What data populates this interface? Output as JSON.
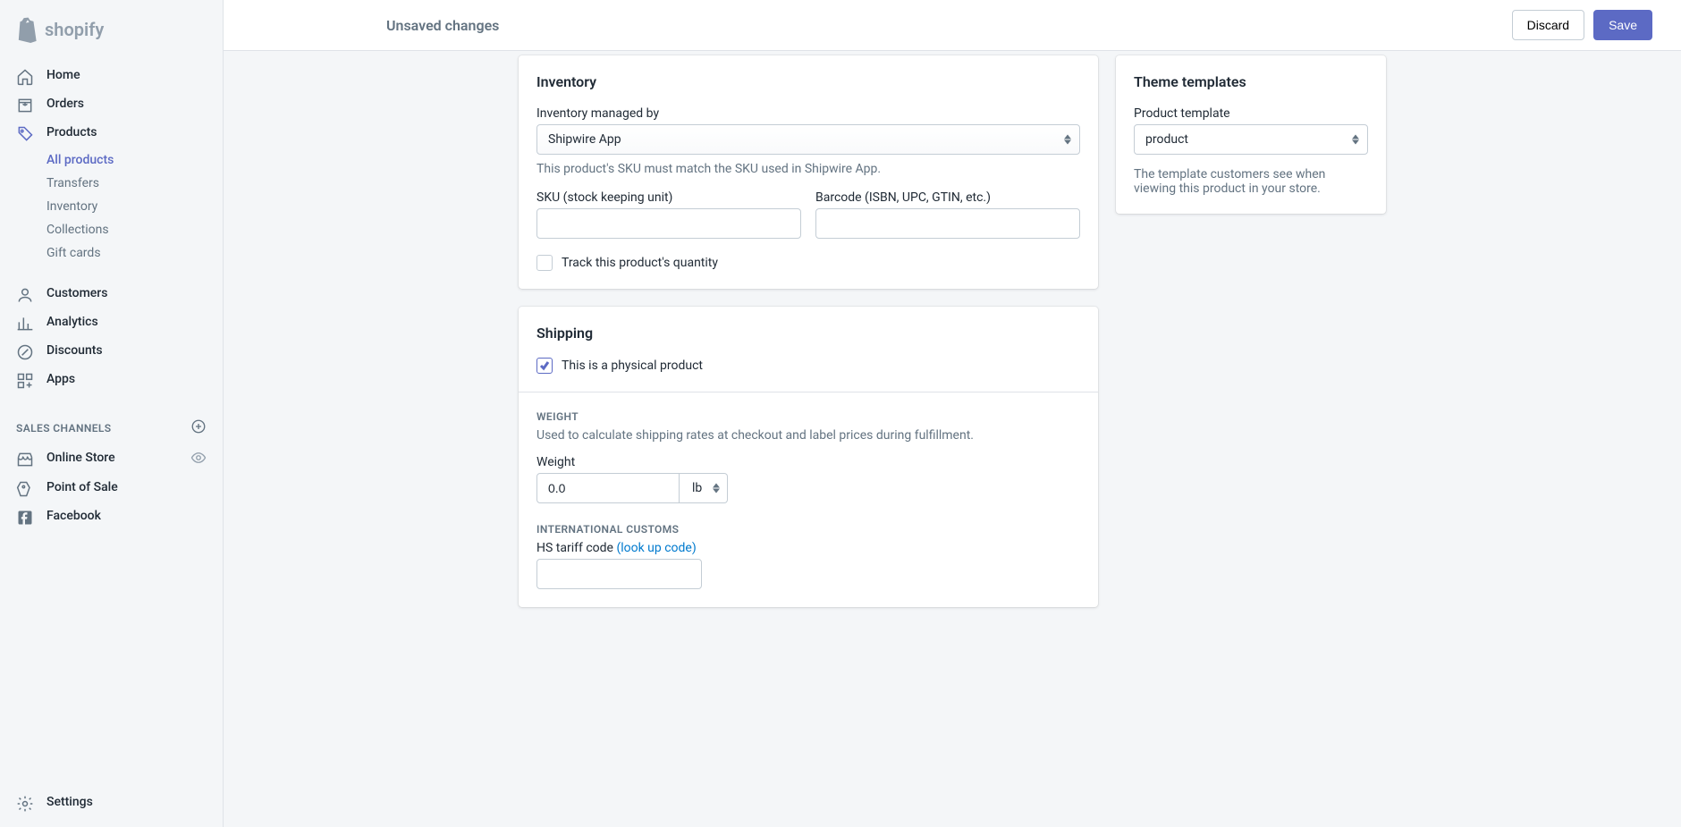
{
  "brand": "shopify",
  "topbar": {
    "title": "Unsaved changes",
    "discard": "Discard",
    "save": "Save"
  },
  "nav": {
    "home": "Home",
    "orders": "Orders",
    "products": "Products",
    "products_sub": {
      "all": "All products",
      "transfers": "Transfers",
      "inventory": "Inventory",
      "collections": "Collections",
      "gift_cards": "Gift cards"
    },
    "customers": "Customers",
    "analytics": "Analytics",
    "discounts": "Discounts",
    "apps": "Apps",
    "sales_channels": "SALES CHANNELS",
    "online_store": "Online Store",
    "point_of_sale": "Point of Sale",
    "facebook": "Facebook",
    "settings": "Settings"
  },
  "inventory": {
    "heading": "Inventory",
    "managed_by_label": "Inventory managed by",
    "managed_by_value": "Shipwire App",
    "sku_helper": "This product's SKU must match the SKU used in Shipwire App.",
    "sku_label": "SKU (stock keeping unit)",
    "barcode_label": "Barcode (ISBN, UPC, GTIN, etc.)",
    "track_label": "Track this product's quantity"
  },
  "shipping": {
    "heading": "Shipping",
    "physical_label": "This is a physical product",
    "weight_heading": "WEIGHT",
    "weight_helper": "Used to calculate shipping rates at checkout and label prices during fulfillment.",
    "weight_label": "Weight",
    "weight_value": "0.0",
    "weight_unit": "lb",
    "customs_heading": "INTERNATIONAL CUSTOMS",
    "hs_label": "HS tariff code ",
    "hs_link": "(look up code)"
  },
  "theme": {
    "heading": "Theme templates",
    "template_label": "Product template",
    "template_value": "product",
    "helper": "The template customers see when viewing this product in your store."
  }
}
